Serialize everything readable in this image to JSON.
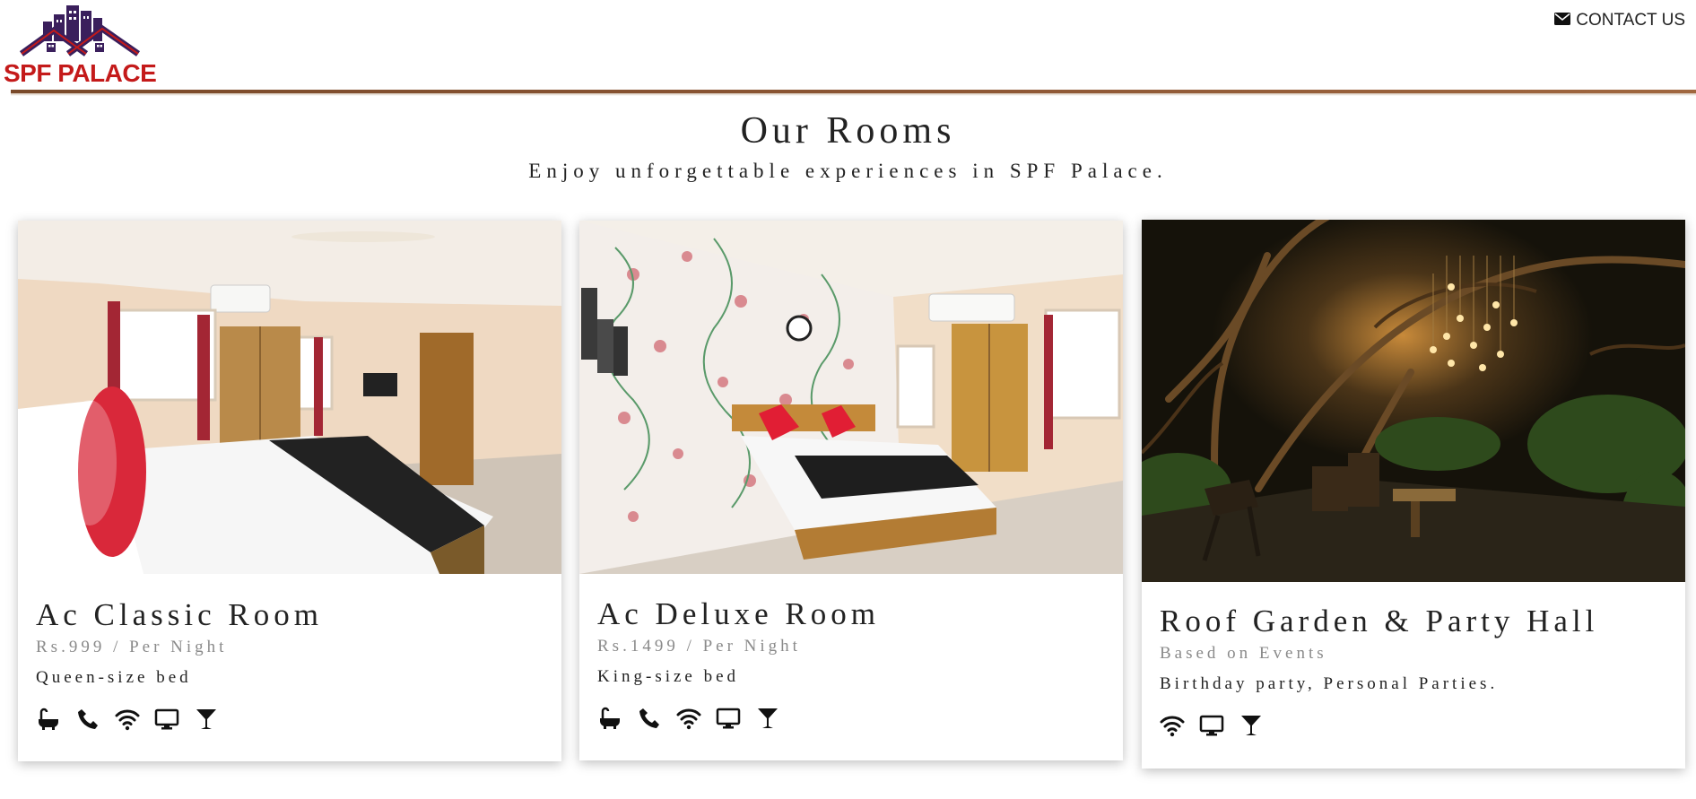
{
  "header": {
    "logo_text": "SPF PALACE",
    "contact_label": "CONTACT US",
    "contact_icon": "envelope-icon"
  },
  "section": {
    "title": "Our Rooms",
    "subtitle": "Enjoy unforgettable experiences in SPF Palace."
  },
  "rooms": [
    {
      "title": "Ac Classic Room",
      "price": "Rs.999 / Per Night",
      "description": "Queen-size bed",
      "image": "hotel-room-bed-image",
      "amenities": [
        "bathtub-icon",
        "phone-icon",
        "wifi-icon",
        "tv-icon",
        "cocktail-icon"
      ]
    },
    {
      "title": "Ac Deluxe Room",
      "price": "Rs.1499 / Per Night",
      "description": "King-size bed",
      "image": "deluxe-room-image",
      "amenities": [
        "bathtub-icon",
        "phone-icon",
        "wifi-icon",
        "tv-icon",
        "cocktail-icon"
      ]
    },
    {
      "title": "Roof Garden & Party Hall",
      "price": "Based on Events",
      "description": "Birthday party, Personal Parties.",
      "image": "roof-garden-night-image",
      "amenities": [
        "wifi-icon",
        "tv-icon",
        "cocktail-icon"
      ]
    }
  ],
  "colors": {
    "brand_red": "#c41a1a",
    "logo_purple": "#3a1f5c",
    "rule_brown": "#8b5533",
    "price_gray": "#8a8a8a"
  }
}
